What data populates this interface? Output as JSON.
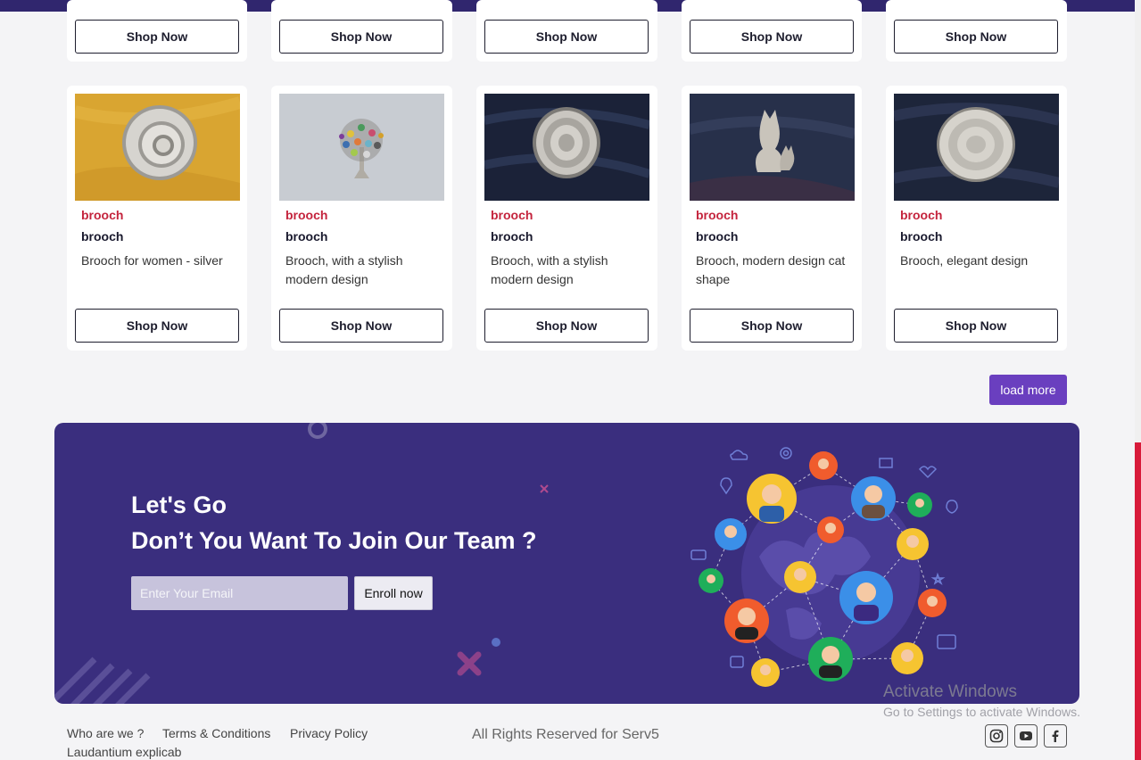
{
  "shop_label": "Shop Now",
  "top_row": [
    {
      "button": "Shop Now"
    },
    {
      "button": "Shop Now"
    },
    {
      "button": "Shop Now"
    },
    {
      "button": "Shop Now"
    },
    {
      "button": "Shop Now"
    }
  ],
  "products": [
    {
      "category": "brooch",
      "name": "brooch",
      "description": "Brooch for women - silver",
      "button": "Shop Now",
      "image": "spiral-brooch-on-yellow"
    },
    {
      "category": "brooch",
      "name": "brooch",
      "description": "Brooch, with a stylish modern design",
      "button": "Shop Now",
      "image": "tree-brooch-on-grey"
    },
    {
      "category": "brooch",
      "name": "brooch",
      "description": "Brooch, with a stylish modern design",
      "button": "Shop Now",
      "image": "round-coil-brooch-on-navy"
    },
    {
      "category": "brooch",
      "name": "brooch",
      "description": "Brooch, modern design cat shape",
      "button": "Shop Now",
      "image": "cat-brooch-on-navy"
    },
    {
      "category": "brooch",
      "name": "brooch",
      "description": "Brooch, elegant design",
      "button": "Shop Now",
      "image": "disc-brooch-on-navy"
    }
  ],
  "load_more": "load more",
  "banner": {
    "heading_1": "Let's Go",
    "heading_2": "Don’t You Want To Join Our Team ?",
    "email_placeholder": "Enter Your Email",
    "enroll_label": "Enroll now"
  },
  "footer": {
    "links": [
      "Who are we ?",
      "Terms & Conditions",
      "Privacy Policy"
    ],
    "extra_link": "Laudantium explicab",
    "copyright": "All Rights Reserved for Serv5",
    "social": [
      "instagram-icon",
      "youtube-icon",
      "facebook-icon"
    ]
  },
  "watermark": {
    "line_1": "Activate Windows",
    "line_2": "Go to Settings to activate Windows."
  },
  "colors": {
    "brand_dark": "#30266e",
    "banner": "#3a2e7e",
    "category_red": "#c4243d",
    "load_more": "#6a3fbf"
  }
}
